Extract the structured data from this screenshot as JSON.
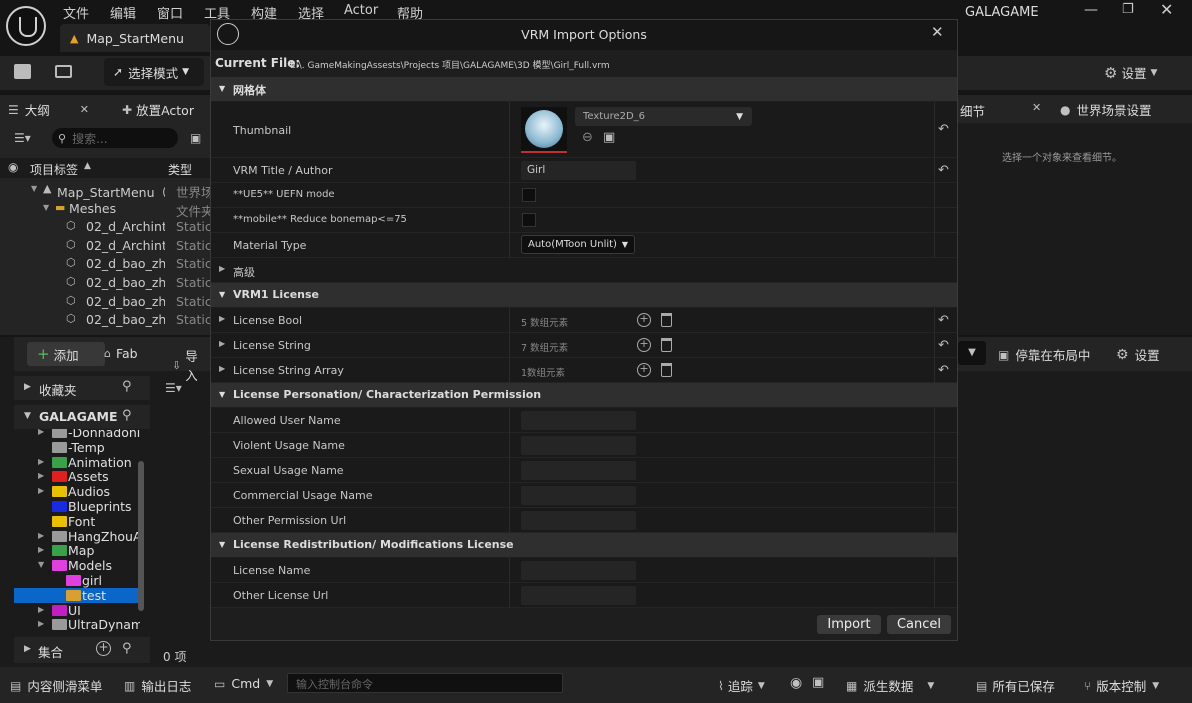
{
  "menu": {
    "items": [
      "文件",
      "编辑",
      "窗口",
      "工具",
      "构建",
      "选择",
      "Actor",
      "帮助"
    ],
    "project": "GALAGAME"
  },
  "tab": {
    "title": "Map_StartMenu"
  },
  "toolbar": {
    "mode": "选择模式",
    "settings": "设置"
  },
  "outliner": {
    "tab": "大纲",
    "place_tab": "放置Actor",
    "search_placeholder": "搜索...",
    "col_label": "项目标签",
    "col_type": "类型",
    "rows": [
      {
        "label": "Map_StartMenu（",
        "type": "世界场"
      },
      {
        "label": "Meshes",
        "type": "文件夹"
      },
      {
        "label": "02_d_Archinte",
        "type": "Static"
      },
      {
        "label": "02_d_Archinte",
        "type": "Static"
      },
      {
        "label": "02_d_bao_zhe",
        "type": "Static"
      },
      {
        "label": "02_d_bao_zhe",
        "type": "Static"
      },
      {
        "label": "02_d_bao_zhe",
        "type": "Static"
      },
      {
        "label": "02_d_bao_zhe",
        "type": "Static"
      }
    ]
  },
  "details": {
    "tab": "细节",
    "world_tab": "世界场景设置",
    "empty": "选择一个对象来查看细节。"
  },
  "content": {
    "add": "添加",
    "fab": "Fab",
    "import": "导入",
    "favorites": "收藏夹",
    "project": "GALAGAME",
    "collections": "集合",
    "count": "0 项",
    "folders": [
      "-Donnadoni",
      "-Temp",
      "Animation",
      "Assets",
      "Audios",
      "Blueprints",
      "Font",
      "HangZhouAj",
      "Map",
      "Models",
      "girl",
      "test",
      "UI",
      "UltraDynam"
    ],
    "folder_colors": [
      "#9a9a9a",
      "#9a9a9a",
      "#3aa04a",
      "#e02020",
      "#e8c000",
      "#1a2ae0",
      "#e8c000",
      "#9a9a9a",
      "#3aa04a",
      "#e040e0",
      "#e040e0",
      "#d8a030",
      "#c020c0",
      "#9a9a9a"
    ],
    "dock": "停靠在布局中",
    "settings": "设置"
  },
  "dialog": {
    "title": "VRM Import Options",
    "current_file_label": "Current File:",
    "current_file": "E:\\. GameMakingAssests\\Projects 项目\\GALAGAME\\3D 模型\\Girl_Full.vrm",
    "sec_mesh": "网格体",
    "thumbnail": "Thumbnail",
    "texture": "Texture2D_6",
    "title_author": "VRM Title / Author",
    "title_value": "Girl",
    "uefn": "**UE5** UEFN mode",
    "mobile": "**mobile** Reduce bonemap<=75",
    "material_type": "Material Type",
    "material_value": "Auto(MToon Unlit)",
    "advanced": "高级",
    "sec_vrm1": "VRM1 License",
    "license_rows": [
      {
        "label": "License Bool",
        "count": "5 数组元素"
      },
      {
        "label": "License String",
        "count": "7 数组元素"
      },
      {
        "label": "License String Array",
        "count": "1数组元素"
      }
    ],
    "sec_person": "License Personation/ Characterization Permission",
    "person_rows": [
      "Allowed User Name",
      "Violent Usage Name",
      "Sexual Usage Name",
      "Commercial Usage Name",
      "Other Permission Url"
    ],
    "sec_redist": "License Redistribution/ Modifications License",
    "redist_rows": [
      "License Name",
      "Other License Url"
    ],
    "import": "Import",
    "cancel": "Cancel"
  },
  "status": {
    "drawer": "内容侧滑菜单",
    "log": "输出日志",
    "cmd": "Cmd",
    "console_placeholder": "输入控制台命令",
    "trace": "追踪",
    "derived": "派生数据",
    "saved": "所有已保存",
    "vc": "版本控制"
  }
}
